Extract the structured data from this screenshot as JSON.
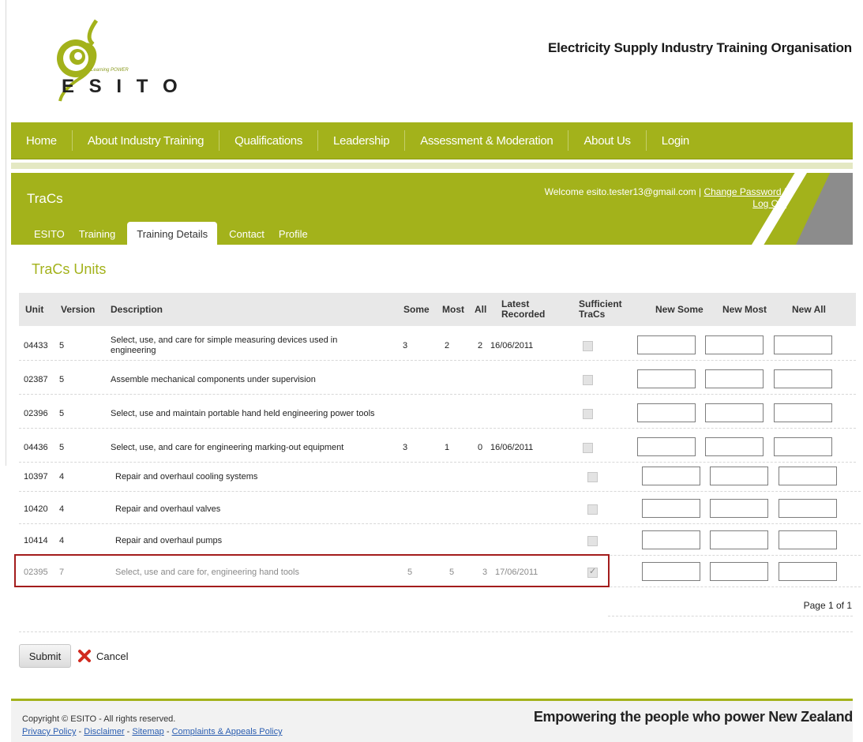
{
  "header": {
    "logo_text": "E S I T O",
    "logo_tagline": "Learning POWER",
    "org_title": "Electricity Supply Industry Training Organisation"
  },
  "nav": {
    "items": [
      "Home",
      "About Industry Training",
      "Qualifications",
      "Leadership",
      "Assessment & Moderation",
      "About Us",
      "Login"
    ]
  },
  "tracs": {
    "title": "TraCs",
    "welcome_prefix": "Welcome esito.tester13@gmail.com |",
    "change_password": "Change Password",
    "logout": "Log Out",
    "tabs": [
      "ESITO",
      "Training",
      "Training Details",
      "Contact",
      "Profile"
    ],
    "active_tab": "Training Details"
  },
  "units": {
    "title": "TraCs Units",
    "columns": [
      "Unit",
      "Version",
      "Description",
      "Some",
      "Most",
      "All",
      "Latest Recorded",
      "Sufficient TraCs",
      "New Some",
      "New Most",
      "New All"
    ],
    "rows": [
      {
        "unit": "04433",
        "version": "5",
        "description": "Select, use, and care for simple measuring devices used in engineering",
        "some": "3",
        "most": "2",
        "all": "2",
        "latest": "16/06/2011",
        "sufficient": false
      },
      {
        "unit": "02387",
        "version": "5",
        "description": "Assemble mechanical components under supervision",
        "some": "",
        "most": "",
        "all": "",
        "latest": "",
        "sufficient": false
      },
      {
        "unit": "02396",
        "version": "5",
        "description": "Select, use and maintain portable hand held engineering power tools",
        "some": "",
        "most": "",
        "all": "",
        "latest": "",
        "sufficient": false
      },
      {
        "unit": "04436",
        "version": "5",
        "description": "Select, use, and care for engineering marking-out equipment",
        "some": "3",
        "most": "1",
        "all": "0",
        "latest": "16/06/2011",
        "sufficient": false
      },
      {
        "unit": "10397",
        "version": "4",
        "description": "Repair and overhaul cooling systems",
        "some": "",
        "most": "",
        "all": "",
        "latest": "",
        "sufficient": false
      },
      {
        "unit": "10420",
        "version": "4",
        "description": "Repair and overhaul valves",
        "some": "",
        "most": "",
        "all": "",
        "latest": "",
        "sufficient": false
      },
      {
        "unit": "10414",
        "version": "4",
        "description": "Repair and overhaul pumps",
        "some": "",
        "most": "",
        "all": "",
        "latest": "",
        "sufficient": false
      },
      {
        "unit": "02395",
        "version": "7",
        "description": "Select, use and care for, engineering hand tools",
        "some": "5",
        "most": "5",
        "all": "3",
        "latest": "17/06/2011",
        "sufficient": true
      }
    ],
    "pager": "Page 1 of 1"
  },
  "actions": {
    "submit": "Submit",
    "cancel": "Cancel"
  },
  "footer": {
    "copyright": "Copyright © ESITO - All rights reserved.",
    "links": [
      "Privacy Policy",
      "Disclaimer",
      "Sitemap",
      "Complaints & Appeals Policy"
    ],
    "slogan": "Empowering the people who power New Zealand"
  },
  "colors": {
    "brand_green": "#a3b21b",
    "highlight_red": "#a31c1c",
    "grey_wedge": "#8c8c8c"
  }
}
